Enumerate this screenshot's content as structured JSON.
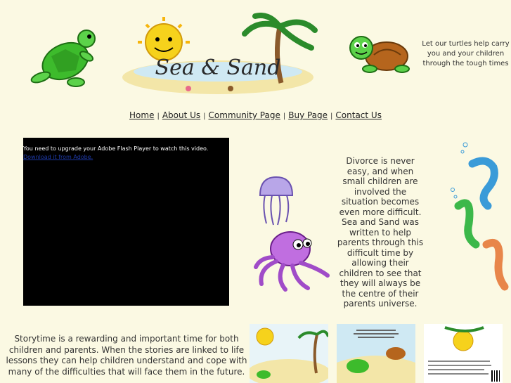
{
  "header": {
    "tagline": "Let our turtles help carry you and your children through the tough times",
    "logo_text": "Sea & Sand"
  },
  "nav": {
    "items": [
      "Home",
      "About Us",
      "Community Page",
      "Buy Page",
      "Contact Us"
    ],
    "separator": "|"
  },
  "flash": {
    "message": "You need to upgrade your Adobe Flash Player to watch this video.",
    "link": "Download it from Adobe."
  },
  "blurb": "Divorce is never easy, and when small children are involved the situation becomes even more difficult. Sea and Sand was written to help parents through this difficult time by allowing their children to see that they will always be the centre of their parents universe.",
  "storytime": "Storytime is a rewarding and important time for both children and parents. When the stories are linked to life lessons they can help children understand and cope with many of the difficulties that will face them in the future.",
  "colors": {
    "background": "#fbf9e3",
    "turtle_green": "#3dbb2c",
    "sun_yellow": "#f6d21c",
    "octopus": "#c06ee0",
    "jellyfish": "#b8a6e8",
    "seahorse_blue": "#3a9bd8",
    "seahorse_green": "#3cb84a",
    "seahorse_orange": "#e8864a"
  }
}
